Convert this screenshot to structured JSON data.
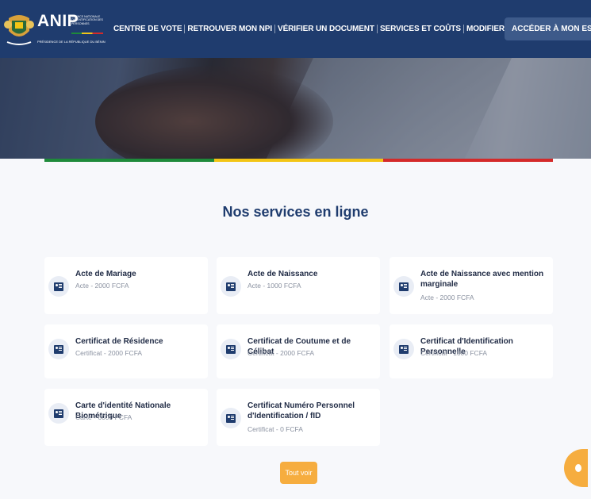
{
  "brand": {
    "name": "ANIP",
    "subtitle": "Agence Nationale d'Identification des Personnes",
    "presidency": "Présidence de la République du Bénin"
  },
  "nav": {
    "items": [
      "CENTRE DE VOTE",
      "RETROUVER MON NPI",
      "VÉRIFIER UN DOCUMENT",
      "SERVICES ET COÛTS",
      "MODIFIER MON NUMÉRO"
    ],
    "cta": "ACCÉDER À MON ESPACE"
  },
  "section": {
    "title": "Nos services en ligne"
  },
  "services": [
    {
      "title": "Acte de Mariage",
      "price": "Acte - 2000 FCFA"
    },
    {
      "title": "Acte de Naissance",
      "price": "Acte - 1000 FCFA"
    },
    {
      "title": "Acte de Naissance avec mention marginale",
      "price": "Acte - 2000 FCFA"
    },
    {
      "title": "Certificat de Résidence",
      "price": "Certificat - 2000 FCFA"
    },
    {
      "title": "Certificat de Coutume et de Célibat",
      "price": "Certificat - 2000 FCFA"
    },
    {
      "title": "Certificat d'Identification Personnelle",
      "price": "Certificat - 1000 FCFA"
    },
    {
      "title": "Carte d'identité Nationale Biométrique",
      "price": "Carte - 6000 FCFA"
    },
    {
      "title": "Certificat Numéro Personnel d'Identification / fID",
      "price": "Certificat - 0 FCFA"
    }
  ],
  "actions": {
    "see_all": "Tout voir"
  },
  "colors": {
    "primary": "#1f3c6e",
    "accent": "#f6ad3f",
    "flag_green": "#1e8a3a",
    "flag_yellow": "#f3c515",
    "flag_red": "#d42a2a"
  }
}
